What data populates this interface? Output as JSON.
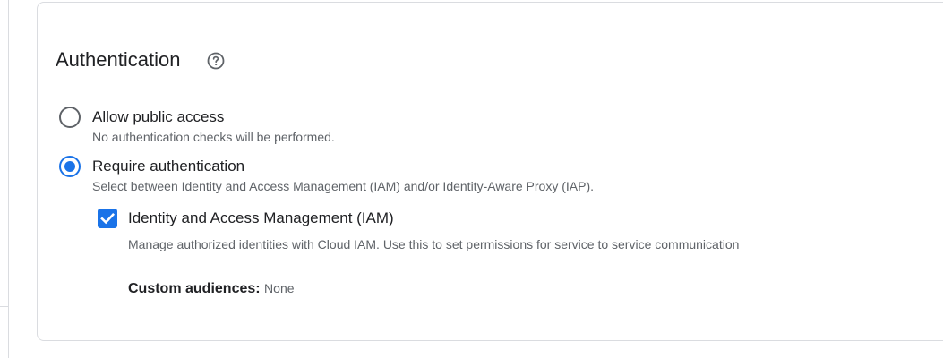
{
  "section": {
    "title": "Authentication",
    "help_icon": "help-circle-icon"
  },
  "options": [
    {
      "label": "Allow public access",
      "description": "No authentication checks will be performed.",
      "selected": false
    },
    {
      "label": "Require authentication",
      "description": "Select between Identity and Access Management (IAM) and/or Identity-Aware Proxy (IAP).",
      "selected": true
    }
  ],
  "iam": {
    "label": "Identity and Access Management (IAM)",
    "description": "Manage authorized identities with Cloud IAM. Use this to set permissions for service to service communication",
    "checked": true,
    "custom_audiences_label": "Custom audiences:",
    "custom_audiences_value": "None"
  },
  "colors": {
    "accent": "#1a73e8",
    "text_primary": "#202124",
    "text_secondary": "#5f6368",
    "border": "#dadce0"
  }
}
